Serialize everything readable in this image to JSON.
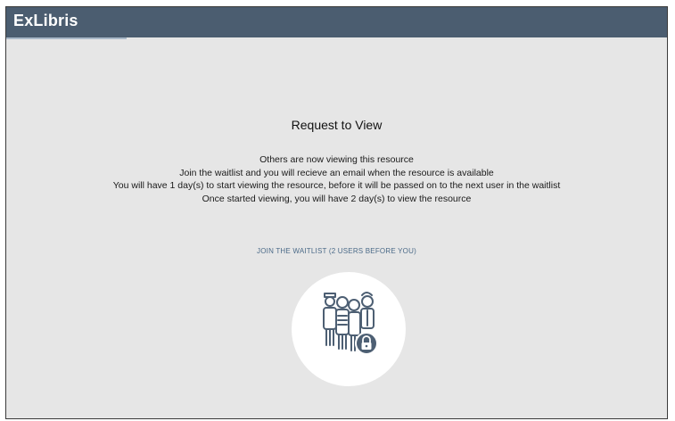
{
  "header": {
    "logo_text": "ExLibris"
  },
  "main": {
    "title": "Request to View",
    "lines": [
      "Others are now viewing this resource",
      "Join the waitlist and you will recieve an email when the resource is available",
      "You will have 1 day(s) to start viewing the resource, before it will be passed on to the next user in the waitlist",
      "Once started viewing, you will  have 2 day(s) to view the resource"
    ],
    "join_label": "JOIN THE WAITLIST (2 USERS BEFORE YOU)",
    "illustration_icon": "waitlist-people-lock-icon"
  },
  "colors": {
    "header_bg": "#4b5d70",
    "page_bg": "#e6e6e6",
    "link": "#4b6a88",
    "icon_stroke": "#4d5f73"
  }
}
